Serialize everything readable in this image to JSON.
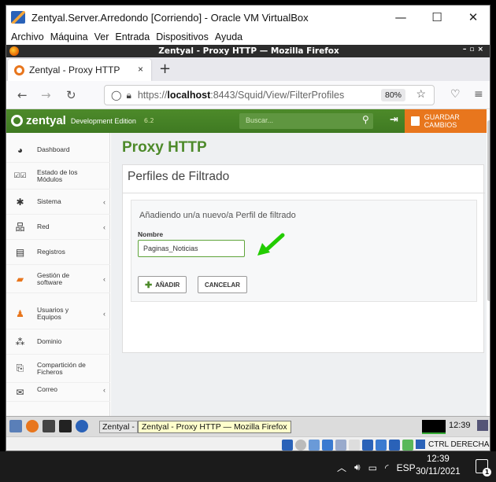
{
  "vbox": {
    "title": "Zentyal.Server.Arredondo [Corriendo] - Oracle VM VirtualBox",
    "window_controls": [
      "—",
      "☐",
      "✕"
    ],
    "menu": [
      "Archivo",
      "Máquina",
      "Ver",
      "Entrada",
      "Dispositivos",
      "Ayuda"
    ],
    "host_key": "CTRL DERECHA"
  },
  "firefox": {
    "window_title": "Zentyal - Proxy HTTP — Mozilla Firefox",
    "tab_title": "Zentyal - Proxy HTTP",
    "tab_close": "×",
    "new_tab": "+",
    "url_prefix": "https://",
    "url_host": "localhost",
    "url_rest": ":8443/Squid/View/FilterProfiles",
    "zoom": "80%"
  },
  "zentyal": {
    "brand": "zentyal",
    "edition": "Development Edition",
    "version": "6.2",
    "search_placeholder": "Buscar...",
    "save_label": "GUARDAR CAMBIOS",
    "page_title": "Proxy HTTP",
    "panel_title": "Perfiles de Filtrado",
    "form_title": "Añadiendo un/a nuevo/a Perfil de filtrado",
    "field_label": "Nombre",
    "field_value": "Paginas_Noticias",
    "add_button": "AÑADIR",
    "cancel_button": "CANCELAR",
    "sidebar": [
      {
        "label": "Dashboard",
        "icon": "dashboard-icon",
        "chevron": false
      },
      {
        "label": "Estado de los Módulos",
        "icon": "modules-icon",
        "chevron": false
      },
      {
        "label": "Sistema",
        "icon": "gear-icon",
        "chevron": true
      },
      {
        "label": "Red",
        "icon": "network-icon",
        "chevron": true
      },
      {
        "label": "Registros",
        "icon": "logs-icon",
        "chevron": false
      },
      {
        "label": "Gestión de software",
        "icon": "software-icon",
        "chevron": true
      },
      {
        "label": "Usuarios y Equipos",
        "icon": "users-icon",
        "chevron": true
      },
      {
        "label": "Dominio",
        "icon": "domain-icon",
        "chevron": false
      },
      {
        "label": "Compartición de Ficheros",
        "icon": "share-icon",
        "chevron": false
      },
      {
        "label": "Correo",
        "icon": "mail-icon",
        "chevron": true
      }
    ]
  },
  "guest_taskbar": {
    "task_label": "Zentyal -",
    "tooltip": "Zentyal - Proxy HTTP — Mozilla Firefox",
    "clock": "12:39"
  },
  "windows": {
    "lang": "ESP",
    "time": "12:39",
    "date": "30/11/2021",
    "notification_count": "1"
  },
  "colors": {
    "zentyal_green": "#4d8a2a",
    "zentyal_orange": "#e8761d",
    "annotation_arrow": "#22cc00"
  }
}
